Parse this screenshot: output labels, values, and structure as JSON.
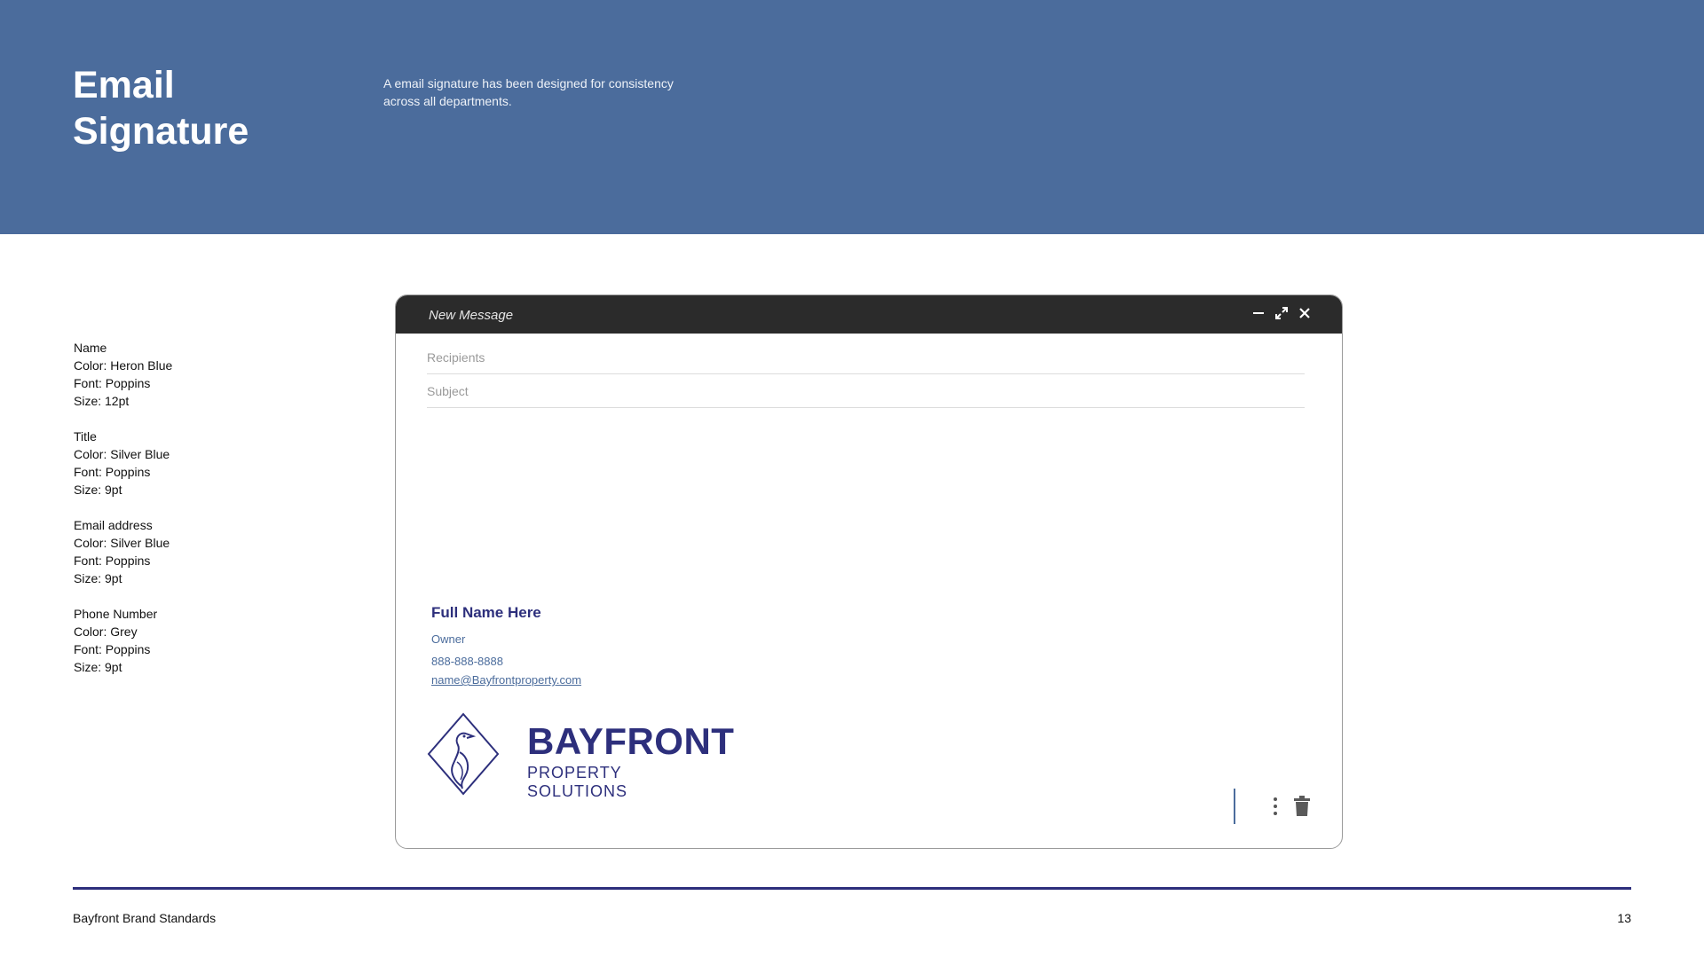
{
  "header": {
    "title_line1": "Email",
    "title_line2": "Signature",
    "intro_line1": "A email signature has been designed for consistency",
    "intro_line2": "across all departments."
  },
  "specs": [
    {
      "label": "Name",
      "color": "Color: Heron Blue",
      "font": "Font: Poppins",
      "size": "Size: 12pt"
    },
    {
      "label": "Title",
      "color": "Color: Silver Blue",
      "font": "Font: Poppins",
      "size": "Size: 9pt"
    },
    {
      "label": "Email address",
      "color": "Color: Silver Blue",
      "font": "Font: Poppins",
      "size": "Size: 9pt"
    },
    {
      "label": "Phone Number",
      "color": "Color: Grey",
      "font": "Font: Poppins",
      "size": "Size: 9pt"
    }
  ],
  "compose": {
    "title": "New Message",
    "recipients_placeholder": "Recipients",
    "subject_placeholder": "Subject",
    "controls": [
      "minimize-icon",
      "expand-icon",
      "close-icon"
    ],
    "toolbar_icons": [
      "more-options-icon",
      "trash-icon"
    ]
  },
  "signature": {
    "name": "Full Name Here",
    "title": "Owner",
    "phone": "888-888-8888",
    "email": "name@Bayfrontproperty.com"
  },
  "logo": {
    "word": "BAYFRONT",
    "sub": "PROPERTY SOLUTIONS",
    "icon": "heron-diamond-icon"
  },
  "colors": {
    "header_band": "#4b6c9c",
    "heron_blue": "#2d2f7c",
    "silver_blue": "#4b6c9c",
    "compose_bar": "#2b2b2b"
  },
  "footer": {
    "left": "Bayfront Brand Standards",
    "page_number": "13"
  }
}
